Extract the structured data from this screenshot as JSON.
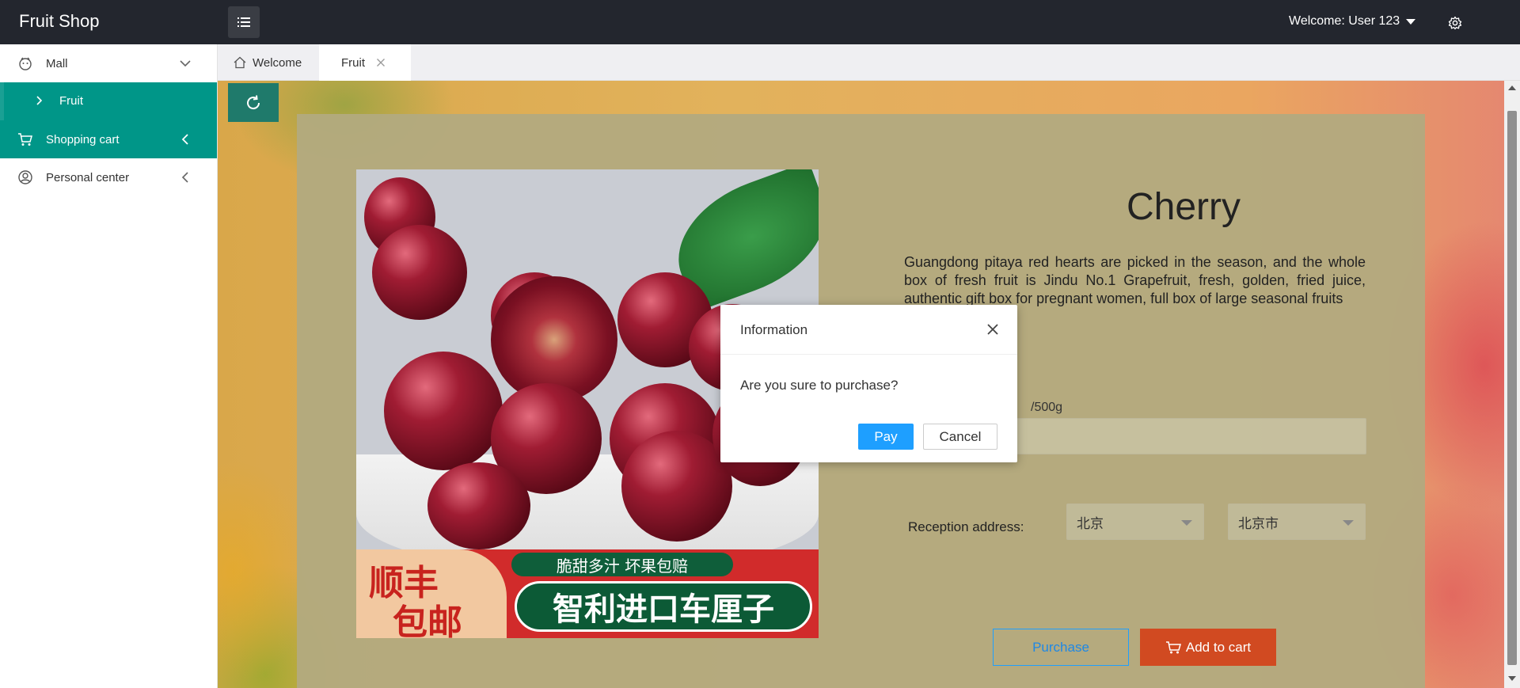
{
  "app": {
    "title": "Fruit Shop"
  },
  "header": {
    "welcome": "Welcome: User 123"
  },
  "sidebar": {
    "items": [
      {
        "label": "Mall",
        "icon": "face-icon"
      },
      {
        "label": "Fruit",
        "icon": "chevron-right-icon"
      },
      {
        "label": "Shopping cart",
        "icon": "cart-icon"
      },
      {
        "label": "Personal center",
        "icon": "user-circle-icon"
      }
    ]
  },
  "tabs": [
    {
      "label": "Welcome",
      "icon": "home-icon"
    },
    {
      "label": "Fruit",
      "icon": "close-icon"
    }
  ],
  "product": {
    "name": "Cherry",
    "description": "Guangdong pitaya red hearts are picked in the season, and the whole box of fresh fruit is Jindu No.1 Grapefruit, fresh, golden, fried juice, authentic gift box for pregnant women, full box of large seasonal fruits",
    "price_fragment": "500g",
    "unit": "/500g",
    "address_label": "Reception address:",
    "province": "北京",
    "city": "北京市",
    "image_text": {
      "free_shipping_1": "顺丰",
      "free_shipping_2": "包邮",
      "tagline": "脆甜多汁 坏果包赔",
      "headline": "智利进口车厘子"
    },
    "purchase_label": "Purchase",
    "add_to_cart_label": "Add to cart"
  },
  "modal": {
    "title": "Information",
    "message": "Are you sure to purchase?",
    "pay_label": "Pay",
    "cancel_label": "Cancel"
  },
  "colors": {
    "header_bg": "#23262e",
    "accent": "#009688",
    "primary_blue": "#1e9fff",
    "cart_orange": "#d14a21",
    "price_red": "#d84a1b"
  }
}
